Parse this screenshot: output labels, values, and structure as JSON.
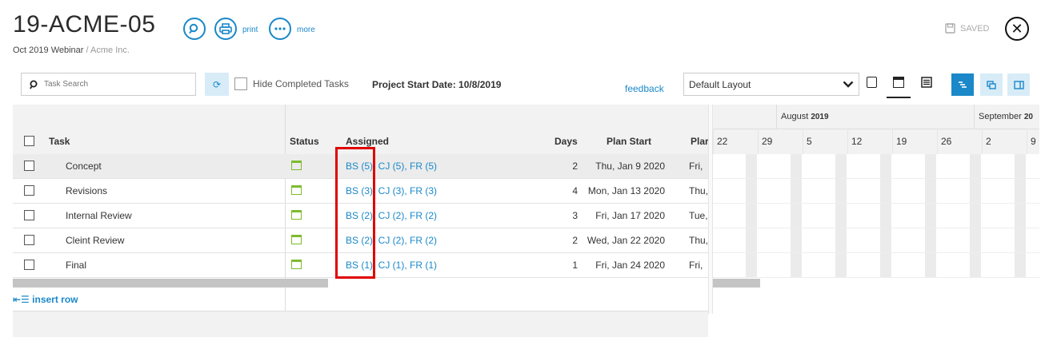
{
  "header": {
    "title": "19-ACME-05",
    "subtitle_main": "Oct 2019 Webinar",
    "subtitle_sep": " / ",
    "subtitle_muted": "Acme Inc.",
    "print_label": "print",
    "more_label": "more",
    "saved_label": "SAVED"
  },
  "toolbar": {
    "search_placeholder": "Task Search",
    "hide_completed_label": "Hide Completed Tasks",
    "project_start": "Project Start Date: 10/8/2019",
    "feedback_label": "feedback",
    "layout_selected": "Default Layout"
  },
  "columns": {
    "task": "Task",
    "status": "Status",
    "assigned": "Assigned",
    "days": "Days",
    "plan_start": "Plan Start",
    "plan_end_partial": "Plar"
  },
  "rows": [
    {
      "task": "Concept",
      "assigned": "BS (5), CJ (5), FR (5)",
      "days": "2",
      "plan_start": "Thu, Jan 9 2020",
      "plan_end": "Fri,"
    },
    {
      "task": "Revisions",
      "assigned": "BS (3), CJ (3), FR (3)",
      "days": "4",
      "plan_start": "Mon, Jan 13 2020",
      "plan_end": "Thu,"
    },
    {
      "task": "Internal Review",
      "assigned": "BS (2), CJ (2), FR (2)",
      "days": "3",
      "plan_start": "Fri, Jan 17 2020",
      "plan_end": "Tue,"
    },
    {
      "task": "Cleint Review",
      "assigned": "BS (2), CJ (2), FR (2)",
      "days": "2",
      "plan_start": "Wed, Jan 22 2020",
      "plan_end": "Thu,"
    },
    {
      "task": "Final",
      "assigned": "BS (1), CJ (1), FR (1)",
      "days": "1",
      "plan_start": "Fri, Jan 24 2020",
      "plan_end": "Fri,"
    }
  ],
  "gantt": {
    "months": [
      {
        "name": "August",
        "year": "2019"
      },
      {
        "name": "September",
        "year": "20"
      }
    ],
    "days": [
      "22",
      "29",
      "5",
      "12",
      "19",
      "26",
      "2",
      "9"
    ]
  },
  "footer": {
    "insert_row_label": "insert row"
  },
  "colors": {
    "accent": "#1a88c9",
    "status_green": "#7dbb2e",
    "highlight_red": "#e00000"
  }
}
